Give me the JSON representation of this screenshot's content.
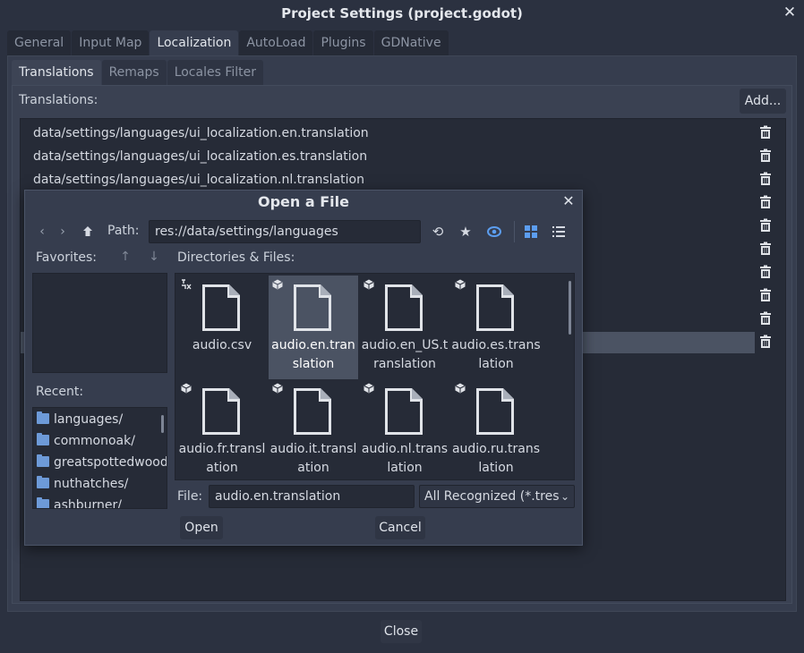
{
  "window": {
    "title": "Project Settings (project.godot)",
    "close_label": "✕",
    "tabs": [
      {
        "label": "General",
        "active": false
      },
      {
        "label": "Input Map",
        "active": false
      },
      {
        "label": "Localization",
        "active": true
      },
      {
        "label": "AutoLoad",
        "active": false
      },
      {
        "label": "Plugins",
        "active": false
      },
      {
        "label": "GDNative",
        "active": false
      }
    ],
    "subtabs": [
      {
        "label": "Translations",
        "active": true
      },
      {
        "label": "Remaps",
        "active": false
      },
      {
        "label": "Locales Filter",
        "active": false
      }
    ],
    "translations_label": "Translations:",
    "add_label": "Add...",
    "translations": [
      "data/settings/languages/ui_localization.en.translation",
      "data/settings/languages/ui_localization.es.translation",
      "data/settings/languages/ui_localization.nl.translation"
    ],
    "close_button_label": "Close"
  },
  "dialog": {
    "title": "Open a File",
    "close_label": "✕",
    "path_label": "Path:",
    "path_value": "res://data/settings/languages",
    "favorites_label": "Favorites:",
    "recent_label": "Recent:",
    "recent": [
      "languages/",
      "commonoak/",
      "greatspottedwoodpecker/",
      "nuthatches/",
      "ashburner/"
    ],
    "dirs_label": "Directories & Files:",
    "files": [
      {
        "name": "audio.csv",
        "badge": "import-icon",
        "selected": false
      },
      {
        "name": "audio.en.translation",
        "badge": "resource-icon",
        "selected": true
      },
      {
        "name": "audio.en_US.translation",
        "badge": "resource-icon",
        "selected": false
      },
      {
        "name": "audio.es.translation",
        "badge": "resource-icon",
        "selected": false
      },
      {
        "name": "audio.fr.translation",
        "badge": "resource-icon",
        "selected": false
      },
      {
        "name": "audio.it.translation",
        "badge": "resource-icon",
        "selected": false
      },
      {
        "name": "audio.nl.translation",
        "badge": "resource-icon",
        "selected": false
      },
      {
        "name": "audio.ru.translation",
        "badge": "resource-icon",
        "selected": false
      }
    ],
    "file_label": "File:",
    "file_value": "audio.en.translation",
    "filter_value": "All Recognized (*.tres",
    "open_label": "Open",
    "cancel_label": "Cancel"
  },
  "colors": {
    "accent": "#5c9ef0",
    "selected_row": "#4b5363",
    "panel": "#363d4e",
    "list_bg": "#262b37"
  }
}
